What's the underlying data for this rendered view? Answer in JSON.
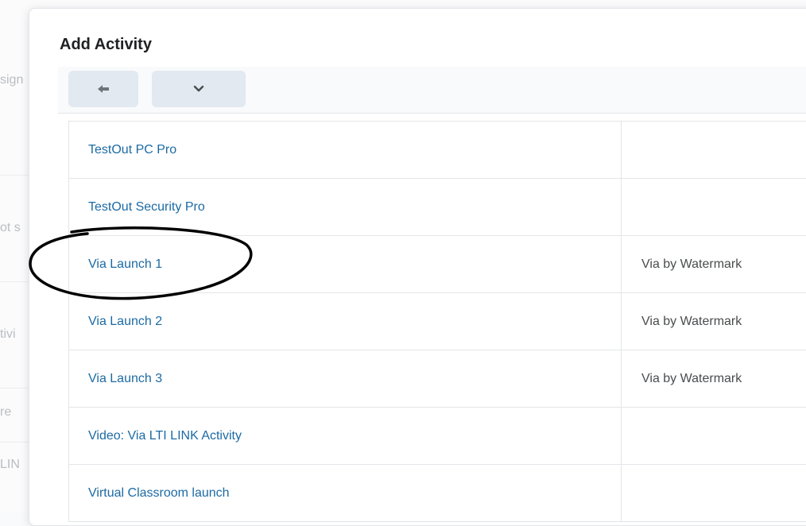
{
  "background": {
    "fragments": [
      "sign",
      "ot s",
      "tivi",
      "re",
      "LIN"
    ]
  },
  "dialog": {
    "title": "Add Activity",
    "toolbar": {
      "back_icon": "arrow-left-icon",
      "more_icon": "chevron-down-icon"
    },
    "rows": [
      {
        "name": "TestOut PC Pro",
        "provider": ""
      },
      {
        "name": "TestOut Security Pro",
        "provider": ""
      },
      {
        "name": "Via Launch 1",
        "provider": "Via by Watermark"
      },
      {
        "name": "Via Launch 2",
        "provider": "Via by Watermark"
      },
      {
        "name": "Via Launch 3",
        "provider": "Via by Watermark"
      },
      {
        "name": "Video: Via LTI LINK Activity",
        "provider": ""
      },
      {
        "name": "Virtual Classroom launch",
        "provider": ""
      }
    ],
    "colors": {
      "link": "#1c6aa3",
      "button_bg": "#e3e9f1"
    }
  }
}
